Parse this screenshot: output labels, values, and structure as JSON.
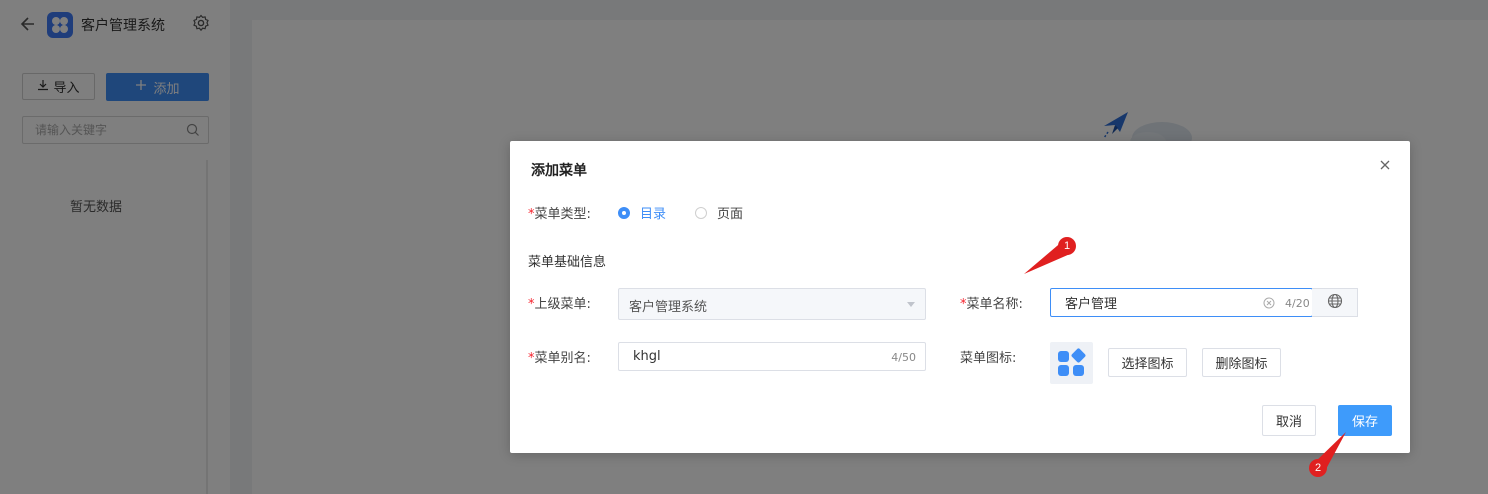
{
  "app": {
    "title": "客户管理系统"
  },
  "sidebar": {
    "import_label": "导入",
    "add_label": "添加",
    "search_placeholder": "请输入关键字",
    "empty_text": "暂无数据"
  },
  "dialog": {
    "title": "添加菜单",
    "menu_type": {
      "label": "菜单类型:",
      "options": [
        {
          "label": "目录",
          "selected": true
        },
        {
          "label": "页面",
          "selected": false
        }
      ]
    },
    "section_title": "菜单基础信息",
    "parent_menu": {
      "label": "上级菜单:",
      "value": "客户管理系统"
    },
    "menu_name": {
      "label": "菜单名称:",
      "value": "客户管理",
      "count": "4/20"
    },
    "menu_alias": {
      "label": "菜单别名:",
      "value": "khgl",
      "count": "4/50"
    },
    "menu_icon": {
      "label": "菜单图标:",
      "icon": "grid-apps-icon",
      "select_label": "选择图标",
      "delete_label": "删除图标"
    },
    "cancel_label": "取消",
    "save_label": "保存",
    "required_mark": "*"
  },
  "annotations": [
    {
      "number": "1",
      "color": "#e02020"
    },
    {
      "number": "2",
      "color": "#e02020"
    }
  ],
  "colors": {
    "primary": "#3e8ef7",
    "save_button": "#3e9bfb",
    "required": "#f5222d",
    "logo": "#3e7bf6",
    "annotation": "#e02020"
  }
}
